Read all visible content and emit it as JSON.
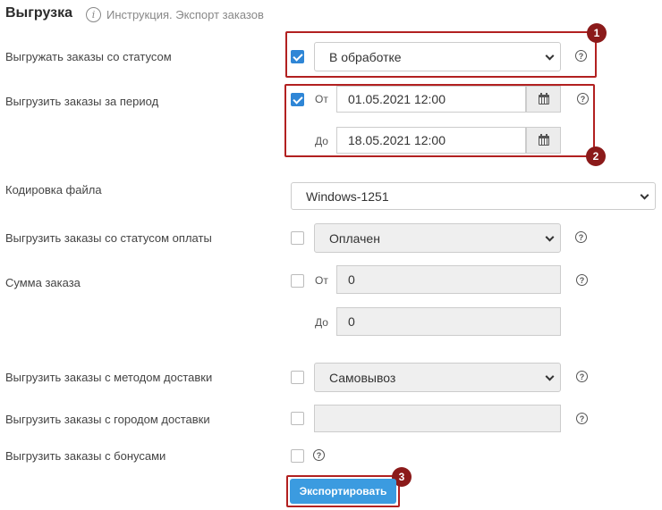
{
  "header": {
    "title": "Выгрузка",
    "help_icon": "info-icon",
    "help_link": "Инструкция. Экспорт заказов"
  },
  "rows": {
    "status": {
      "label": "Выгружать заказы со статусом",
      "checked": true,
      "value": "В обработке"
    },
    "period": {
      "label": "Выгрузить заказы за период",
      "checked": true,
      "from_label": "От",
      "from_value": "01.05.2021 12:00",
      "to_label": "До",
      "to_value": "18.05.2021 12:00"
    },
    "encoding": {
      "label": "Кодировка файла",
      "value": "Windows-1251"
    },
    "payment_status": {
      "label": "Выгрузить заказы со статусом оплаты",
      "checked": false,
      "value": "Оплачен"
    },
    "order_sum": {
      "label": "Сумма заказа",
      "checked": false,
      "from_label": "От",
      "from_value": "0",
      "to_label": "До",
      "to_value": "0"
    },
    "delivery_method": {
      "label": "Выгрузить заказы с методом доставки",
      "checked": false,
      "value": "Самовывоз"
    },
    "delivery_city": {
      "label": "Выгрузить заказы с городом доставки",
      "checked": false,
      "value": ""
    },
    "bonuses": {
      "label": "Выгрузить заказы с бонусами",
      "checked": false
    }
  },
  "help_mark": "?",
  "export_button": "Экспортировать",
  "annotations": {
    "badge_1": "1",
    "badge_2": "2",
    "badge_3": "3",
    "color": "#b22020"
  },
  "colors": {
    "accent": "#2f86d6",
    "button": "#3b9be0"
  }
}
